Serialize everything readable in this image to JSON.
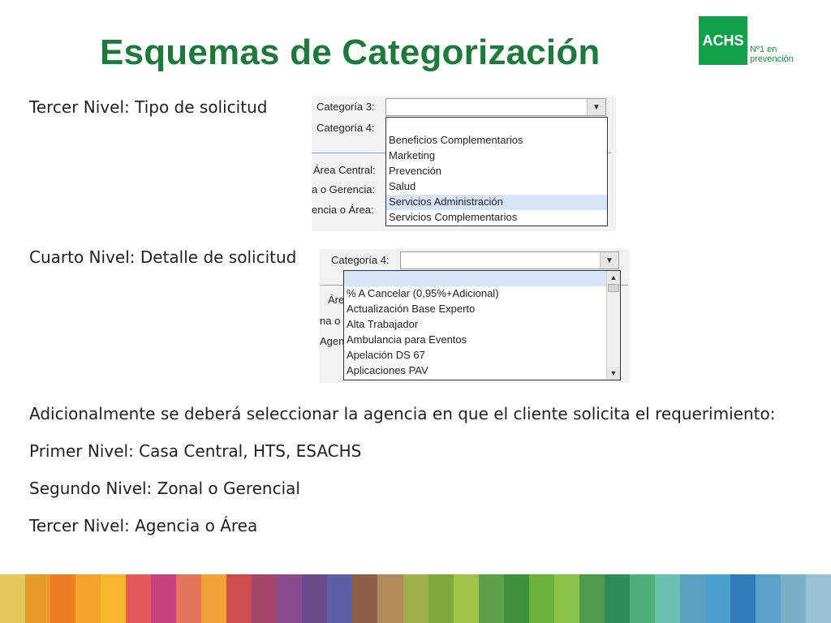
{
  "title": "Esquemas de Categorización",
  "logo": {
    "brand": "ACHS",
    "tag_line1": "Nº1 en",
    "tag_line2": "prevención"
  },
  "section1": {
    "label": "Tercer Nivel: Tipo de solicitud",
    "field_label": "Categoría 3:",
    "field2_label": "Categoría 4:",
    "side_labels": [
      "Área Central:",
      "a o Gerencia:",
      "encia o Área:"
    ],
    "options": [
      "Beneficios Complementarios",
      "Marketing",
      "Prevención",
      "Salud",
      "Servicios Administración",
      "Servicios Complementarios"
    ],
    "selected_option": "Servicios Administración"
  },
  "section2": {
    "label": "Cuarto Nivel: Detalle de solicitud",
    "field_label": "Categoría 4:",
    "side_labels": [
      "Áre",
      "na o",
      "Agen"
    ],
    "options": [
      "% A Cancelar (0,95%+Adicional)",
      "Actualización Base Experto",
      "Alta Trabajador",
      "Ambulancia para Eventos",
      "Apelación DS 67",
      "Aplicaciones PAV"
    ]
  },
  "text": {
    "line1": "Adicionalmente se deberá seleccionar la agencia en que el cliente solicita el requerimiento:",
    "line2": "Primer Nivel: Casa Central, HTS, ESACHS",
    "line3": "Segundo Nivel: Zonal o Gerencial",
    "line4": "Tercer Nivel: Agencia o Área"
  },
  "colors": {
    "title": "#1e7a3c",
    "brand": "#14a04a",
    "stripes": [
      "#e3c85a",
      "#e59a2a",
      "#ef7d22",
      "#f2a329",
      "#f6b72c",
      "#e25a5a",
      "#c7437d",
      "#e3765a",
      "#f2a23a",
      "#ce4c4c",
      "#a4456c",
      "#8b4a8d",
      "#6d4a8a",
      "#5c5fa3",
      "#8d5f4a",
      "#b08a5a",
      "#9db04a",
      "#7da83a",
      "#a3c24a",
      "#5fa04a",
      "#3e8f3a",
      "#6ab23a",
      "#8cc24a",
      "#4f9a4a",
      "#2f8c5a",
      "#4fb07a",
      "#6cc0b0",
      "#5aa0c0",
      "#4aa0d0",
      "#2e7db8",
      "#5aa0c8",
      "#7ab0c8",
      "#9ac2d6"
    ]
  }
}
